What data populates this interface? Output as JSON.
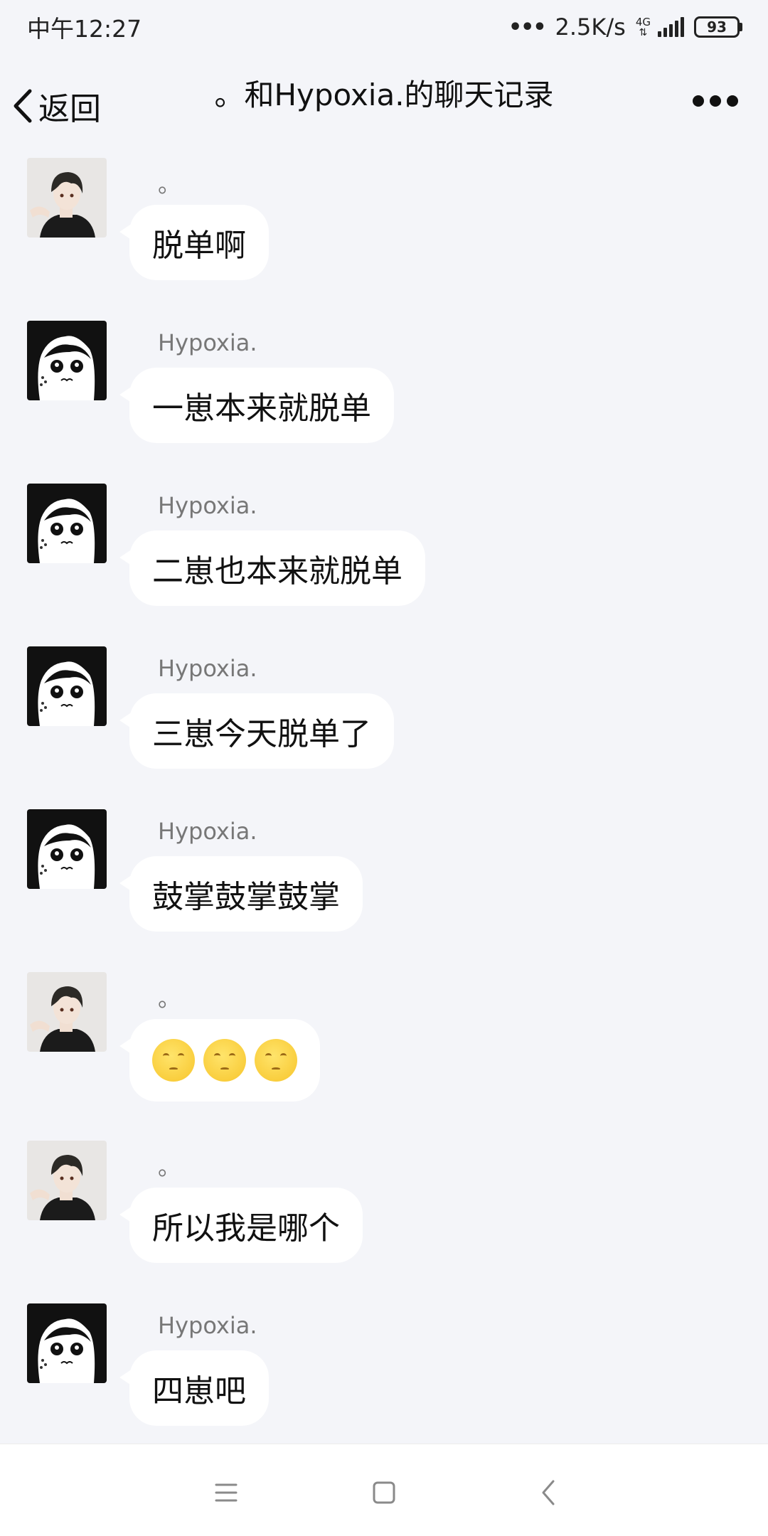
{
  "status_bar": {
    "time": "中午12:27",
    "dots": "•••",
    "net_speed": "2.5K/s",
    "network": "4G",
    "battery": "93"
  },
  "header": {
    "back_label": "返回",
    "title": "。和Hypoxia.的聊天记录"
  },
  "messages": [
    {
      "sender": "。",
      "avatar": "boy-avatar",
      "text": "脱单啊"
    },
    {
      "sender": "Hypoxia.",
      "avatar": "girl-avatar",
      "text": "一崽本来就脱单"
    },
    {
      "sender": "Hypoxia.",
      "avatar": "girl-avatar",
      "text": "二崽也本来就脱单"
    },
    {
      "sender": "Hypoxia.",
      "avatar": "girl-avatar",
      "text": "三崽今天脱单了"
    },
    {
      "sender": "Hypoxia.",
      "avatar": "girl-avatar",
      "text": "鼓掌鼓掌鼓掌"
    },
    {
      "sender": "。",
      "avatar": "boy-avatar",
      "emoji": [
        "pensive-face",
        "pensive-face",
        "pensive-face"
      ]
    },
    {
      "sender": "。",
      "avatar": "boy-avatar",
      "text": "所以我是哪个"
    },
    {
      "sender": "Hypoxia.",
      "avatar": "girl-avatar",
      "text": "四崽吧"
    }
  ],
  "nav_bar": {
    "icons": [
      "menu-icon",
      "home-square-icon",
      "back-chevron-icon"
    ]
  }
}
